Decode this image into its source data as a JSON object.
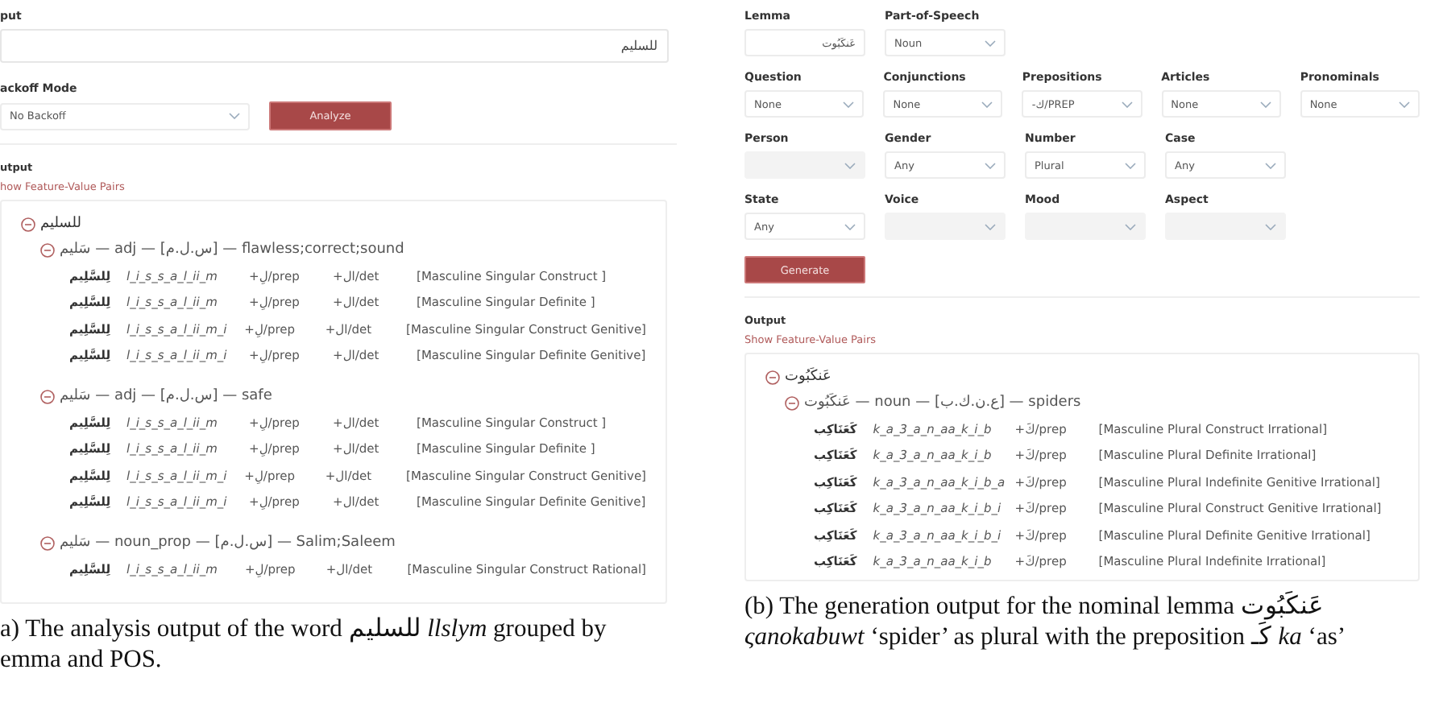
{
  "analysis": {
    "input": {
      "label": "put",
      "value": "للسليم"
    },
    "backoff": {
      "label": "ackoff Mode",
      "value": "No Backoff"
    },
    "button": "Analyze",
    "output_label": "utput",
    "link": "how Feature-Value Pairs",
    "tree": [
      {
        "word": "للسليم",
        "expanded": true,
        "children": [
          {
            "line": "سَليم — adj — [س.ل.م] — flawless;correct;sound",
            "expanded": true,
            "rows": [
              {
                "form": "لِلسَّلِيم",
                "translit": "l_i_s_s_a_l_ii_m",
                "prep": "+لِ/prep",
                "det": "+ال/det",
                "features": "[Masculine Singular Construct ]"
              },
              {
                "form": "لِلسَّلِيم",
                "translit": "l_i_s_s_a_l_ii_m",
                "prep": "+لِ/prep",
                "det": "+ال/det",
                "features": "[Masculine Singular Definite ]"
              },
              {
                "form": "لِلسَّلِيم",
                "translit": "l_i_s_s_a_l_ii_m_i",
                "prep": "+لِ/prep",
                "det": "+ال/det",
                "features": "[Masculine Singular Construct Genitive]"
              },
              {
                "form": "لِلسَّلِيم",
                "translit": "l_i_s_s_a_l_ii_m_i",
                "prep": "+لِ/prep",
                "det": "+ال/det",
                "features": "[Masculine Singular Definite Genitive]"
              }
            ]
          },
          {
            "line": "سَليم — adj — [س.ل.م] — safe",
            "expanded": true,
            "rows": [
              {
                "form": "لِلسَّلِيم",
                "translit": "l_i_s_s_a_l_ii_m",
                "prep": "+لِ/prep",
                "det": "+ال/det",
                "features": "[Masculine Singular Construct ]"
              },
              {
                "form": "لِلسَّلِيم",
                "translit": "l_i_s_s_a_l_ii_m",
                "prep": "+لِ/prep",
                "det": "+ال/det",
                "features": "[Masculine Singular Definite ]"
              },
              {
                "form": "لِلسَّلِيم",
                "translit": "l_i_s_s_a_l_ii_m_i",
                "prep": "+لِ/prep",
                "det": "+ال/det",
                "features": "[Masculine Singular Construct Genitive]"
              },
              {
                "form": "لِلسَّلِيم",
                "translit": "l_i_s_s_a_l_ii_m_i",
                "prep": "+لِ/prep",
                "det": "+ال/det",
                "features": "[Masculine Singular Definite Genitive]"
              }
            ]
          },
          {
            "line": "سَليم — noun_prop — [س.ل.م] — Salim;Saleem",
            "expanded": true,
            "rows": [
              {
                "form": "لِلسَّلِيم",
                "translit": "l_i_s_s_a_l_ii_m",
                "prep": "+لِ/prep",
                "det": "+ال/det",
                "features": "[Masculine Singular Construct Rational]"
              }
            ]
          }
        ]
      }
    ],
    "caption": [
      "a) The analysis output of the word للسليم *llslym* grouped by",
      "emma and POS."
    ]
  },
  "generation": {
    "field_rows": [
      {
        "lemma": {
          "label": "Lemma",
          "kind": "text",
          "value": "عَنكَبُوت"
        },
        "part_of_speech": {
          "label": "Part-of-Speech",
          "kind": "select",
          "value": "Noun",
          "disabled": false
        }
      },
      {
        "question": {
          "label": "Question",
          "kind": "select",
          "value": "None",
          "disabled": false
        },
        "conjunctions": {
          "label": "Conjunctions",
          "kind": "select",
          "value": "None",
          "disabled": false
        },
        "prepositions": {
          "label": "Prepositions",
          "kind": "select",
          "value": "-ك/PREP",
          "disabled": false
        },
        "articles": {
          "label": "Articles",
          "kind": "select",
          "value": "None",
          "disabled": false
        },
        "pronominals": {
          "label": "Pronominals",
          "kind": "select",
          "value": "None",
          "disabled": false
        }
      },
      {
        "person": {
          "label": "Person",
          "kind": "select",
          "disabled": true
        },
        "gender": {
          "label": "Gender",
          "kind": "select",
          "value": "Any",
          "disabled": false
        },
        "number": {
          "label": "Number",
          "kind": "select",
          "value": "Plural",
          "disabled": false
        },
        "case": {
          "label": "Case",
          "kind": "select",
          "value": "Any",
          "disabled": false
        }
      },
      {
        "state": {
          "label": "State",
          "kind": "select",
          "value": "Any",
          "disabled": false
        },
        "voice": {
          "label": "Voice",
          "kind": "select",
          "disabled": true
        },
        "mood": {
          "label": "Mood",
          "kind": "select",
          "disabled": true
        },
        "aspect": {
          "label": "Aspect",
          "kind": "select",
          "disabled": true
        }
      }
    ],
    "button": "Generate",
    "output_label": "Output",
    "link": "Show Feature-Value Pairs",
    "tree": [
      {
        "word": "عَنكَبُوت",
        "expanded": true,
        "children": [
          {
            "line": "عَنكَبُوت — noun — [ع.ن.ك.ب] — spiders",
            "expanded": true,
            "rows": [
              {
                "form": "كَعَنَاكِب",
                "translit": "k_a_3_a_n_aa_k_i_b",
                "prep": "+كَ/prep",
                "features": "[Masculine Plural Construct Irrational]"
              },
              {
                "form": "كَعَنَاكِب",
                "translit": "k_a_3_a_n_aa_k_i_b",
                "prep": "+كَ/prep",
                "features": "[Masculine Plural Definite Irrational]"
              },
              {
                "form": "كَعَنَاكِب",
                "translit": "k_a_3_a_n_aa_k_i_b_a",
                "prep": "+كَ/prep",
                "features": "[Masculine Plural Indefinite Genitive Irrational]"
              },
              {
                "form": "كَعَنَاكِب",
                "translit": "k_a_3_a_n_aa_k_i_b_i",
                "prep": "+كَ/prep",
                "features": "[Masculine Plural Construct Genitive Irrational]"
              },
              {
                "form": "كَعَنَاكِب",
                "translit": "k_a_3_a_n_aa_k_i_b_i",
                "prep": "+كَ/prep",
                "features": "[Masculine Plural Definite Genitive Irrational]"
              },
              {
                "form": "كَعَنَاكِب",
                "translit": "k_a_3_a_n_aa_k_i_b",
                "prep": "+كَ/prep",
                "features": "[Masculine Plural Indefinite Irrational]"
              }
            ]
          }
        ]
      }
    ],
    "caption": [
      "(b) The generation output for the nominal lemma عَنكَبُوت",
      "*ςanokabuwt* ‘spider’ as plural with the preposition كَـ *ka* ‘as’"
    ]
  }
}
